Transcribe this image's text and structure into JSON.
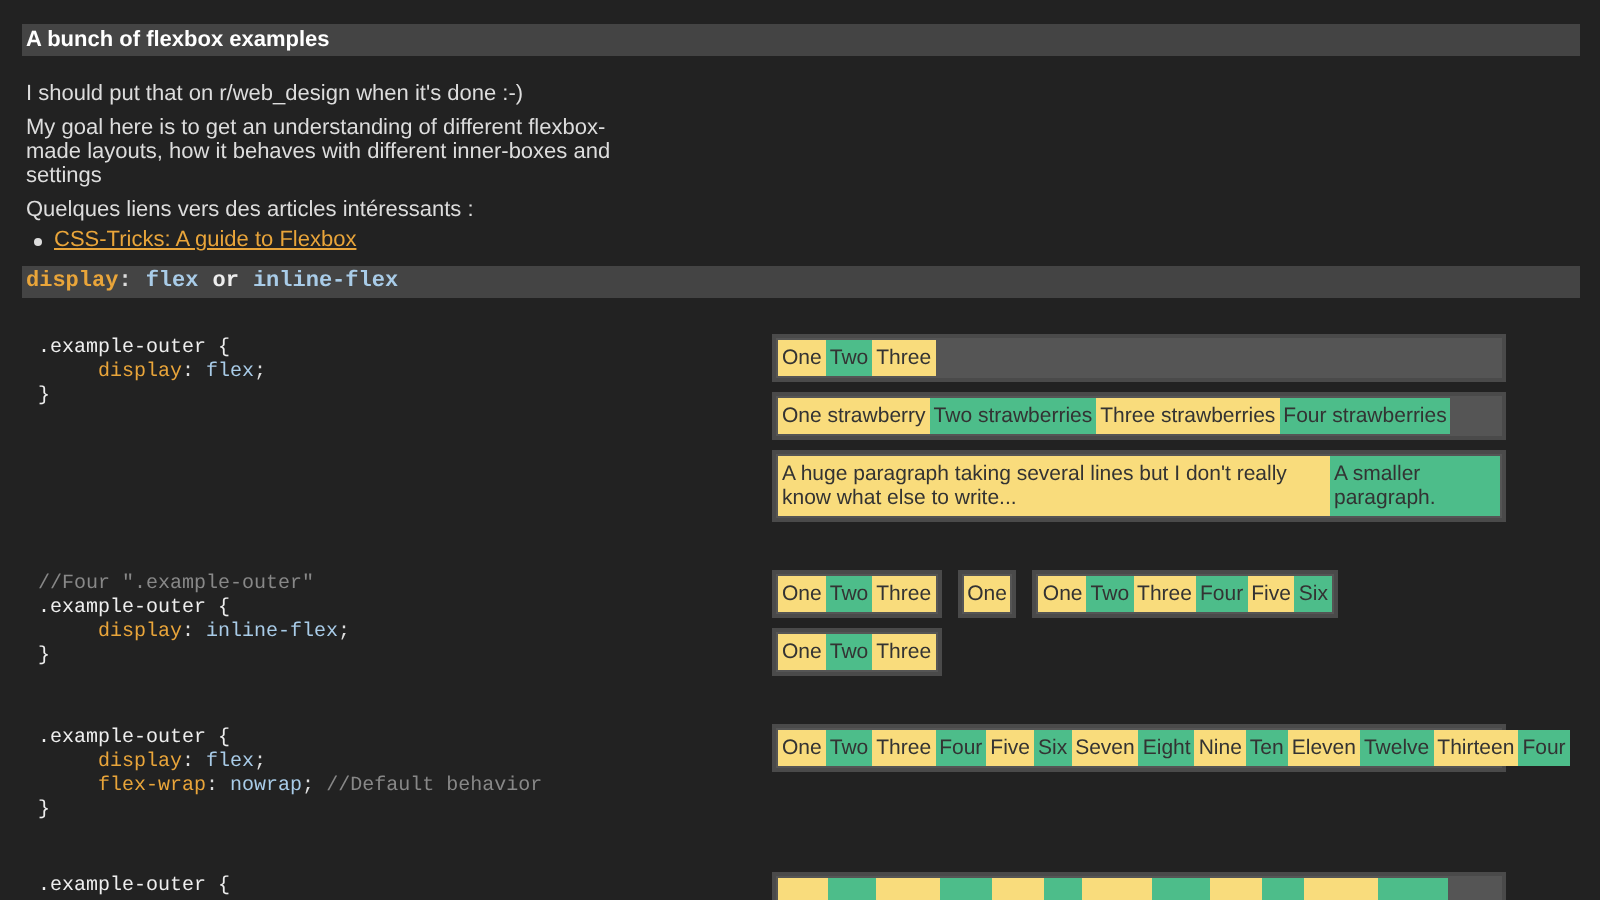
{
  "title": "A bunch of flexbox examples",
  "intro": [
    "I should put that on r/web_design when it's done :-)",
    "My goal here is to get an understanding of different flexbox-made layouts, how it behaves with different inner-boxes and settings",
    "Quelques liens vers des articles intéressants :"
  ],
  "links": [
    "CSS-Tricks: A guide to Flexbox"
  ],
  "section_heading": [
    {
      "kind": "property",
      "text": "display"
    },
    {
      "kind": "punct",
      "text": ":"
    },
    {
      "kind": "value",
      "text": "flex"
    },
    {
      "kind": "plain",
      "text": "or"
    },
    {
      "kind": "value",
      "text": "inline-flex"
    }
  ],
  "examples": [
    {
      "code": [
        {
          "kind": "plain",
          "tokens": [
            {
              "kind": "selector",
              "text": ".example-outer {"
            }
          ]
        },
        {
          "kind": "indented",
          "tokens": [
            {
              "kind": "property",
              "text": "display"
            },
            {
              "kind": "punct",
              "text": ": "
            },
            {
              "kind": "value",
              "text": "flex"
            },
            {
              "kind": "punct",
              "text": ";"
            }
          ]
        },
        {
          "kind": "plain",
          "tokens": [
            {
              "kind": "selector",
              "text": "}"
            }
          ]
        }
      ],
      "rows": [
        [
          {
            "kind": "block",
            "items": [
              "One",
              "Two",
              "Three"
            ]
          }
        ],
        [
          {
            "kind": "block",
            "items": [
              "One strawberry",
              "Two strawberries",
              "Three strawberries",
              "Four strawberries"
            ]
          }
        ],
        [
          {
            "kind": "block",
            "items": [
              "A huge paragraph taking several lines but I don't really know what else to write...",
              "A smaller paragraph."
            ]
          }
        ]
      ]
    },
    {
      "code": [
        {
          "kind": "plain",
          "tokens": [
            {
              "kind": "comment",
              "text": "//Four \".example-outer\""
            }
          ]
        },
        {
          "kind": "plain",
          "tokens": [
            {
              "kind": "selector",
              "text": ".example-outer {"
            }
          ]
        },
        {
          "kind": "indented",
          "tokens": [
            {
              "kind": "property",
              "text": "display"
            },
            {
              "kind": "punct",
              "text": ": "
            },
            {
              "kind": "value",
              "text": "inline-flex"
            },
            {
              "kind": "punct",
              "text": ";"
            }
          ]
        },
        {
          "kind": "plain",
          "tokens": [
            {
              "kind": "selector",
              "text": "}"
            }
          ]
        }
      ],
      "rows": [
        [
          {
            "kind": "inline",
            "items": [
              "One",
              "Two",
              "Three"
            ]
          },
          {
            "kind": "inline",
            "items": [
              "One"
            ]
          },
          {
            "kind": "inline",
            "items": [
              "One",
              "Two",
              "Three",
              "Four",
              "Five",
              "Six"
            ]
          }
        ],
        [
          {
            "kind": "inline",
            "items": [
              "One",
              "Two",
              "Three"
            ]
          }
        ]
      ]
    },
    {
      "code": [
        {
          "kind": "plain",
          "tokens": [
            {
              "kind": "selector",
              "text": ".example-outer {"
            }
          ]
        },
        {
          "kind": "indented",
          "tokens": [
            {
              "kind": "property",
              "text": "display"
            },
            {
              "kind": "punct",
              "text": ": "
            },
            {
              "kind": "value",
              "text": "flex"
            },
            {
              "kind": "punct",
              "text": ";"
            }
          ]
        },
        {
          "kind": "indented",
          "tokens": [
            {
              "kind": "property",
              "text": "flex-wrap"
            },
            {
              "kind": "punct",
              "text": ": "
            },
            {
              "kind": "value",
              "text": "nowrap"
            },
            {
              "kind": "punct",
              "text": "; "
            },
            {
              "kind": "comment",
              "text": "//Default behavior"
            }
          ]
        },
        {
          "kind": "plain",
          "tokens": [
            {
              "kind": "selector",
              "text": "}"
            }
          ]
        }
      ],
      "rows": [
        [
          {
            "kind": "overflow",
            "items": [
              "One",
              "Two",
              "Three",
              "Four",
              "Five",
              "Six",
              "Seven",
              "Eight",
              "Nine",
              "Ten",
              "Eleven",
              "Twelve",
              "Thirteen",
              "Four"
            ]
          }
        ]
      ]
    },
    {
      "code": [
        {
          "kind": "plain",
          "tokens": [
            {
              "kind": "selector",
              "text": ".example-outer {"
            }
          ]
        }
      ],
      "rows": [
        [
          {
            "kind": "clipped"
          }
        ]
      ]
    }
  ]
}
